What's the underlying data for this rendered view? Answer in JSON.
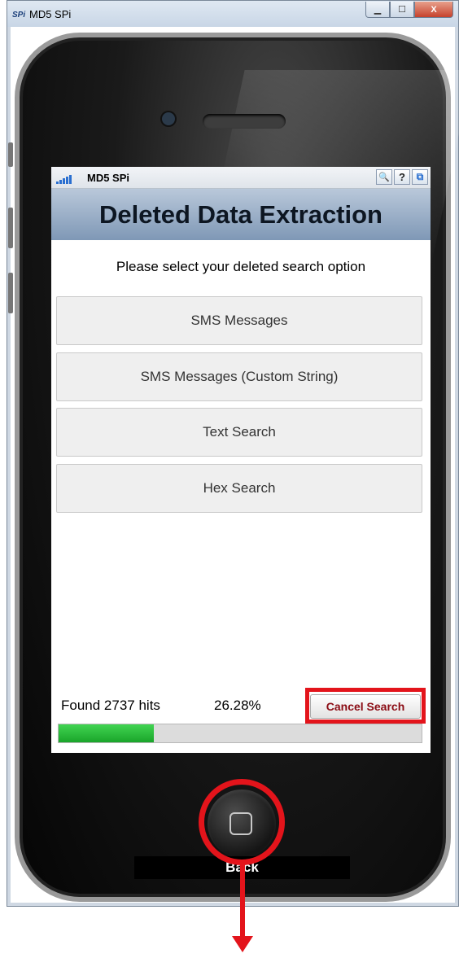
{
  "window": {
    "logo_text": "SPi",
    "title": "MD5 SPi",
    "minimize_glyph": "▁",
    "maximize_glyph": "☐",
    "close_glyph": "X"
  },
  "phone_app": {
    "status_name": "MD5 SPi",
    "icons": {
      "search": "🔍",
      "help": "?",
      "window": "⧉"
    },
    "header_title": "Deleted Data Extraction",
    "prompt": "Please select your deleted search option",
    "options": [
      "SMS Messages",
      "SMS Messages (Custom String)",
      "Text Search",
      "Hex Search"
    ],
    "found_text": "Found 2737 hits",
    "percent_text": "26.28%",
    "progress_fraction": 0.2628,
    "cancel_label": "Cancel Search"
  },
  "back_label": "Back",
  "colors": {
    "highlight_red": "#e3141b",
    "progress_green": "#22b535",
    "header_blue": "#8ea6c2"
  }
}
